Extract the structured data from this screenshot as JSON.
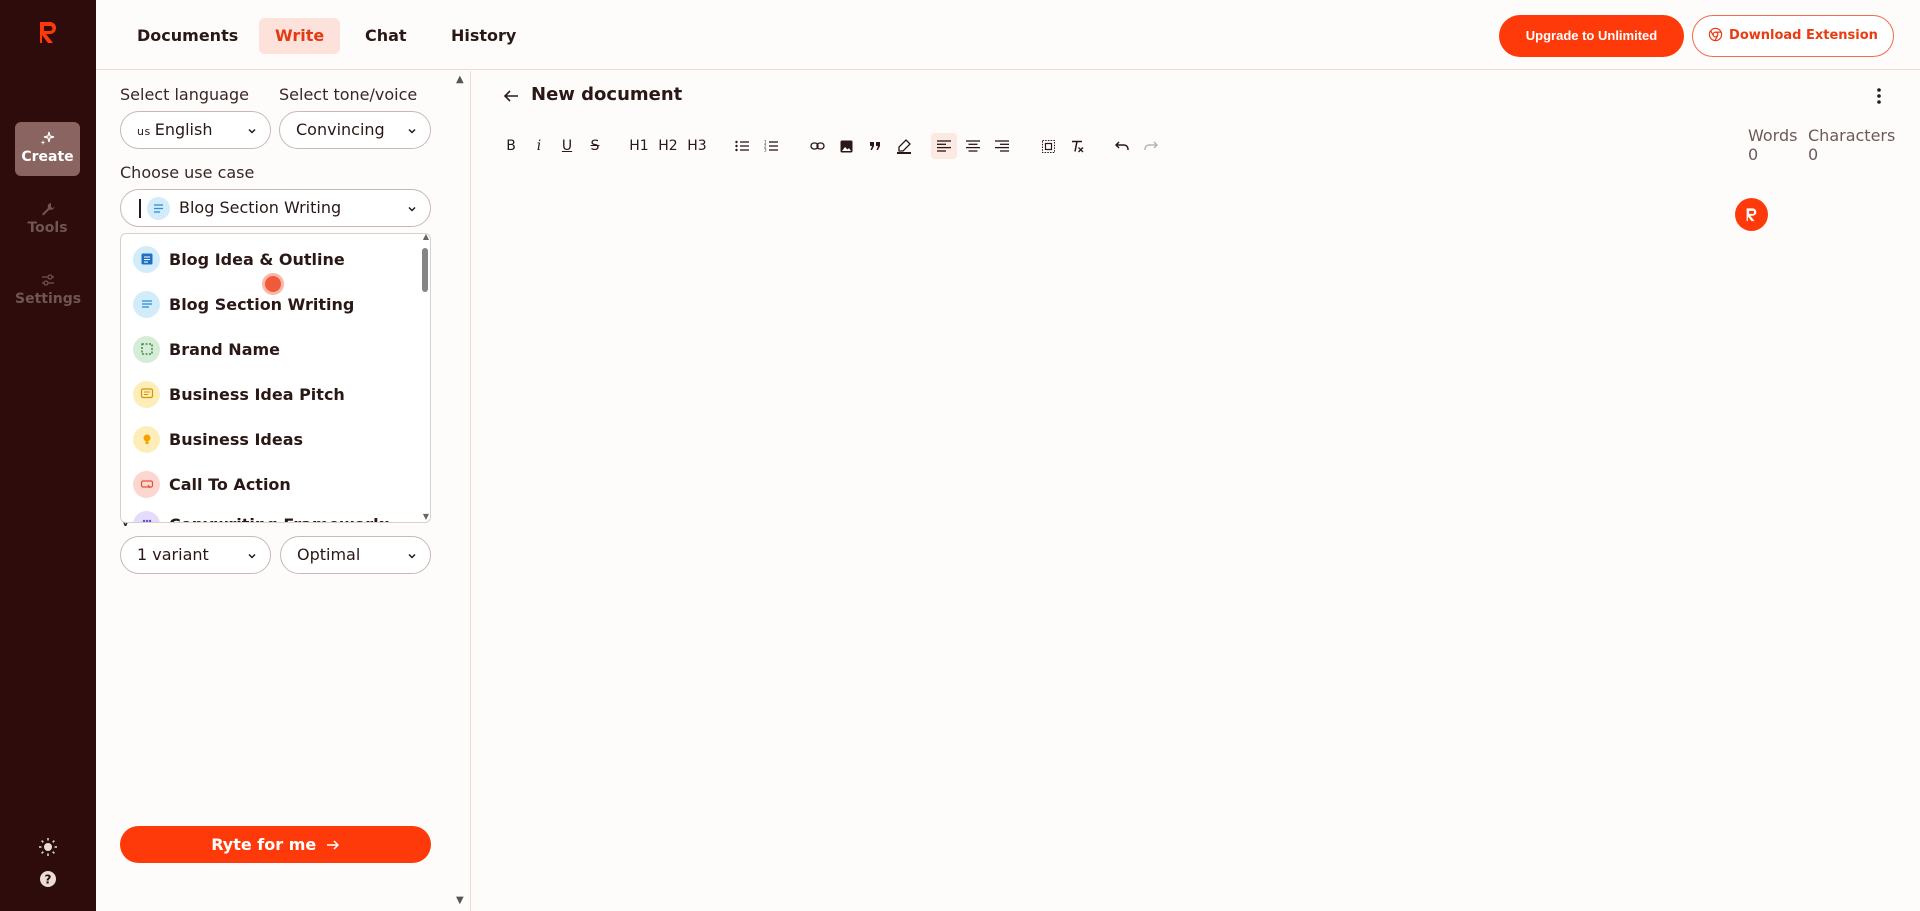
{
  "nav": {
    "tabs": [
      {
        "label": "Documents",
        "active": false
      },
      {
        "label": "Write",
        "active": true
      },
      {
        "label": "Chat",
        "active": false
      },
      {
        "label": "History",
        "active": false
      }
    ],
    "upgrade_label": "Upgrade to Unlimited",
    "download_label": "Download Extension"
  },
  "rail": {
    "items": [
      {
        "label": "Create",
        "icon": "sparkle-icon",
        "active": true
      },
      {
        "label": "Tools",
        "icon": "wrench-icon",
        "active": false
      },
      {
        "label": "Settings",
        "icon": "sliders-icon",
        "active": false
      }
    ],
    "bottom_icons": [
      "sun-icon",
      "help-icon"
    ]
  },
  "panel": {
    "language_label": "Select language",
    "language_flag": "us",
    "language_value": "English",
    "tone_label": "Select tone/voice",
    "tone_value": "Convincing",
    "usecase_label": "Choose use case",
    "usecase_value": "Blog Section Writing",
    "dropdown_items": [
      {
        "label": "Blog Idea & Outline",
        "icon": "document-icon",
        "color": "#d3ecfa"
      },
      {
        "label": "Blog Section Writing",
        "icon": "lines-icon",
        "color": "#d3ecfa"
      },
      {
        "label": "Brand Name",
        "icon": "frame-icon",
        "color": "#d5ecd6"
      },
      {
        "label": "Business Idea Pitch",
        "icon": "message-icon",
        "color": "#fdeeb9"
      },
      {
        "label": "Business Ideas",
        "icon": "bulb-icon",
        "color": "#fdeeb9"
      },
      {
        "label": "Call To Action",
        "icon": "cta-icon",
        "color": "#fcd6cf"
      },
      {
        "label": "Copywriting Framework:",
        "icon": "grid-icon",
        "color": "#e4dcfa"
      }
    ],
    "variants_letter": "V",
    "variants_value": "1 variant",
    "quality_value": "Optimal",
    "ryte_label": "Ryte for me"
  },
  "editor": {
    "title": "New document",
    "toolbar": [
      "B",
      "i",
      "U",
      "S",
      "H1",
      "H2",
      "H3"
    ],
    "words_label": "Words",
    "words_value": "0",
    "chars_label": "Characters",
    "chars_value": "0"
  },
  "colors": {
    "accent": "#ff3a0a",
    "rail_bg": "#2d0c0b",
    "active_tab_bg": "#fce2da"
  }
}
